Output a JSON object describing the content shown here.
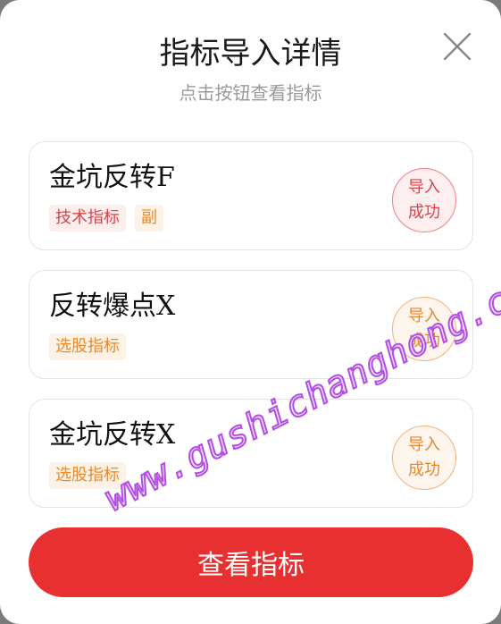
{
  "dialog": {
    "title": "指标导入详情",
    "subtitle": "点击按钮查看指标",
    "close_icon": "close-icon"
  },
  "items": [
    {
      "name": "金坑反转F",
      "tags": [
        "技术指标",
        "副"
      ],
      "status": "导入\n成功",
      "status_line1": "导入",
      "status_line2": "成功",
      "tone": "red"
    },
    {
      "name": "反转爆点X",
      "tags": [
        "选股指标"
      ],
      "status_line1": "导入",
      "status_line2": "成功",
      "tone": "orange"
    },
    {
      "name": "金坑反转X",
      "tags": [
        "选股指标"
      ],
      "status_line1": "导入",
      "status_line2": "成功",
      "tone": "orange"
    }
  ],
  "footer": {
    "view_button_label": "查看指标"
  },
  "watermark": "www.gushichanghong.com",
  "colors": {
    "accent_red": "#e83030",
    "tag_orange": "#e88a2e",
    "tag_red": "#d9434a"
  }
}
